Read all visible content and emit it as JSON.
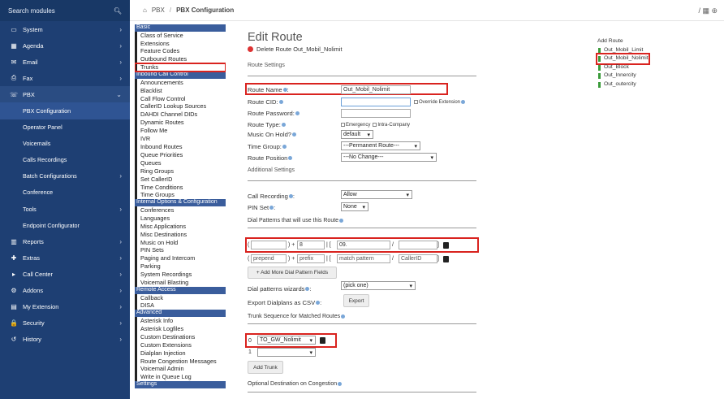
{
  "search": {
    "placeholder": "Search modules"
  },
  "nav": [
    {
      "icon": "▭",
      "label": "System",
      "chev": "›",
      "type": "main"
    },
    {
      "icon": "▦",
      "label": "Agenda",
      "chev": "›",
      "type": "main"
    },
    {
      "icon": "✉",
      "label": "Email",
      "chev": "›",
      "type": "main"
    },
    {
      "icon": "⎙",
      "label": "Fax",
      "chev": "›",
      "type": "main"
    },
    {
      "icon": "☏",
      "label": "PBX",
      "chev": "⌄",
      "type": "active"
    },
    {
      "icon": "",
      "label": "PBX Configuration",
      "chev": "",
      "type": "selected"
    },
    {
      "icon": "",
      "label": "Operator Panel",
      "chev": "",
      "type": "sub"
    },
    {
      "icon": "",
      "label": "Voicemails",
      "chev": "",
      "type": "sub"
    },
    {
      "icon": "",
      "label": "Calls Recordings",
      "chev": "",
      "type": "sub"
    },
    {
      "icon": "",
      "label": "Batch Configurations",
      "chev": "›",
      "type": "sub"
    },
    {
      "icon": "",
      "label": "Conference",
      "chev": "",
      "type": "sub"
    },
    {
      "icon": "",
      "label": "Tools",
      "chev": "›",
      "type": "sub"
    },
    {
      "icon": "",
      "label": "Endpoint Configurator",
      "chev": "",
      "type": "sub"
    },
    {
      "icon": "▥",
      "label": "Reports",
      "chev": "›",
      "type": "main"
    },
    {
      "icon": "✚",
      "label": "Extras",
      "chev": "›",
      "type": "main"
    },
    {
      "icon": "▸",
      "label": "Call Center",
      "chev": "›",
      "type": "main"
    },
    {
      "icon": "⚙",
      "label": "Addons",
      "chev": "›",
      "type": "main"
    },
    {
      "icon": "▤",
      "label": "My Extension",
      "chev": "›",
      "type": "main"
    },
    {
      "icon": "🔒",
      "label": "Security",
      "chev": "›",
      "type": "main"
    },
    {
      "icon": "↺",
      "label": "History",
      "chev": "›",
      "type": "main"
    }
  ],
  "breadcrumb": {
    "home": "PBX",
    "sep": "/",
    "current": "PBX Configuration"
  },
  "modules": [
    {
      "t": "h",
      "label": "Basic"
    },
    {
      "t": "i",
      "label": "Class of Service"
    },
    {
      "t": "i",
      "label": "Extensions"
    },
    {
      "t": "i",
      "label": "Feature Codes"
    },
    {
      "t": "i",
      "label": "Outbound Routes"
    },
    {
      "t": "i",
      "label": "Trunks",
      "hl": true
    },
    {
      "t": "h",
      "label": "Inbound Call Control"
    },
    {
      "t": "i",
      "label": "Announcements"
    },
    {
      "t": "i",
      "label": "Blacklist"
    },
    {
      "t": "i",
      "label": "Call Flow Control"
    },
    {
      "t": "i",
      "label": "CallerID Lookup Sources"
    },
    {
      "t": "i",
      "label": "DAHDI Channel DIDs"
    },
    {
      "t": "i",
      "label": "Dynamic Routes"
    },
    {
      "t": "i",
      "label": "Follow Me"
    },
    {
      "t": "i",
      "label": "IVR"
    },
    {
      "t": "i",
      "label": "Inbound Routes"
    },
    {
      "t": "i",
      "label": "Queue Priorities"
    },
    {
      "t": "i",
      "label": "Queues"
    },
    {
      "t": "i",
      "label": "Ring Groups"
    },
    {
      "t": "i",
      "label": "Set CallerID"
    },
    {
      "t": "i",
      "label": "Time Conditions"
    },
    {
      "t": "i",
      "label": "Time Groups"
    },
    {
      "t": "h",
      "label": "Internal Options & Configuration"
    },
    {
      "t": "i",
      "label": "Conferences"
    },
    {
      "t": "i",
      "label": "Languages"
    },
    {
      "t": "i",
      "label": "Misc Applications"
    },
    {
      "t": "i",
      "label": "Misc Destinations"
    },
    {
      "t": "i",
      "label": "Music on Hold"
    },
    {
      "t": "i",
      "label": "PIN Sets"
    },
    {
      "t": "i",
      "label": "Paging and Intercom"
    },
    {
      "t": "i",
      "label": "Parking"
    },
    {
      "t": "i",
      "label": "System Recordings"
    },
    {
      "t": "i",
      "label": "Voicemail Blasting"
    },
    {
      "t": "h",
      "label": "Remote Access"
    },
    {
      "t": "i",
      "label": "Callback"
    },
    {
      "t": "i",
      "label": "DISA"
    },
    {
      "t": "h",
      "label": "Advanced"
    },
    {
      "t": "i",
      "label": "Asterisk Info"
    },
    {
      "t": "i",
      "label": "Asterisk Logfiles"
    },
    {
      "t": "i",
      "label": "Custom Destinations"
    },
    {
      "t": "i",
      "label": "Custom Extensions"
    },
    {
      "t": "i",
      "label": "Dialplan Injection"
    },
    {
      "t": "i",
      "label": "Route Congestion Messages"
    },
    {
      "t": "i",
      "label": "Voicemail Admin"
    },
    {
      "t": "i",
      "label": "Write in Queue Log"
    },
    {
      "t": "h",
      "label": "Settings"
    }
  ],
  "form": {
    "title": "Edit Route",
    "delete_label": "Delete Route Out_Mobil_Nolimit",
    "route_settings": "Route Settings",
    "route_name_label": "Route Name",
    "route_name_value": "Out_Mobil_Nolimit",
    "route_cid_label": "Route CID:",
    "override_ext": "Override Extension",
    "route_password_label": "Route Password:",
    "route_type_label": "Route Type:",
    "emergency": "Emergency",
    "intra_company": "Intra-Company",
    "moh_label": "Music On Hold?",
    "moh_value": "default",
    "time_group_label": "Time Group:",
    "time_group_value": "---Permanent Route---",
    "route_position_label": "Route Position",
    "route_position_value": "---No Change---",
    "additional_settings": "Additional Settings",
    "call_recording_label": "Call Recording",
    "call_recording_value": "Allow",
    "pin_set_label": "PIN Set",
    "pin_set_value": "None",
    "dial_patterns_label": "Dial Patterns that will use this Route",
    "dp1": {
      "open": "(",
      "prepend": "",
      "close_plus": ") +",
      "prefix": "8",
      "bar": "| [",
      "match": "09.",
      "slash": "/",
      "cid": "",
      "end": "]"
    },
    "dp2": {
      "open": "(",
      "prepend": "prepend",
      "close_plus": ") +",
      "prefix": "prefix",
      "bar": "| [",
      "match": "match pattern",
      "slash": "/",
      "cid": "CallerID",
      "end": "]"
    },
    "add_more_label": "+ Add More Dial Pattern Fields",
    "wizards_label": "Dial patterns wizards",
    "wizards_value": "(pick one)",
    "export_label": "Export Dialplans as CSV",
    "export_btn": "Export",
    "trunk_seq_label": "Trunk Sequence for Matched Routes",
    "trunk0_idx": "0",
    "trunk0_value": "TO_GW_Nolimit",
    "trunk1_idx": "1",
    "trunk1_value": "",
    "add_trunk": "Add Trunk",
    "optional_dest": "Optional Destination on Congestion"
  },
  "tree": {
    "title": "Add Route",
    "items": [
      {
        "label": "Out_Mobil_Limit"
      },
      {
        "label": "Out_Mobil_Nolimit",
        "hl": true
      },
      {
        "label": "Out_Block"
      },
      {
        "label": "Out_Innercity"
      },
      {
        "label": "Out_outercity"
      }
    ]
  },
  "colors": {
    "sidebar": "#1e3f73",
    "highlight": "#d9231f",
    "module_header": "#3a5d9c"
  }
}
